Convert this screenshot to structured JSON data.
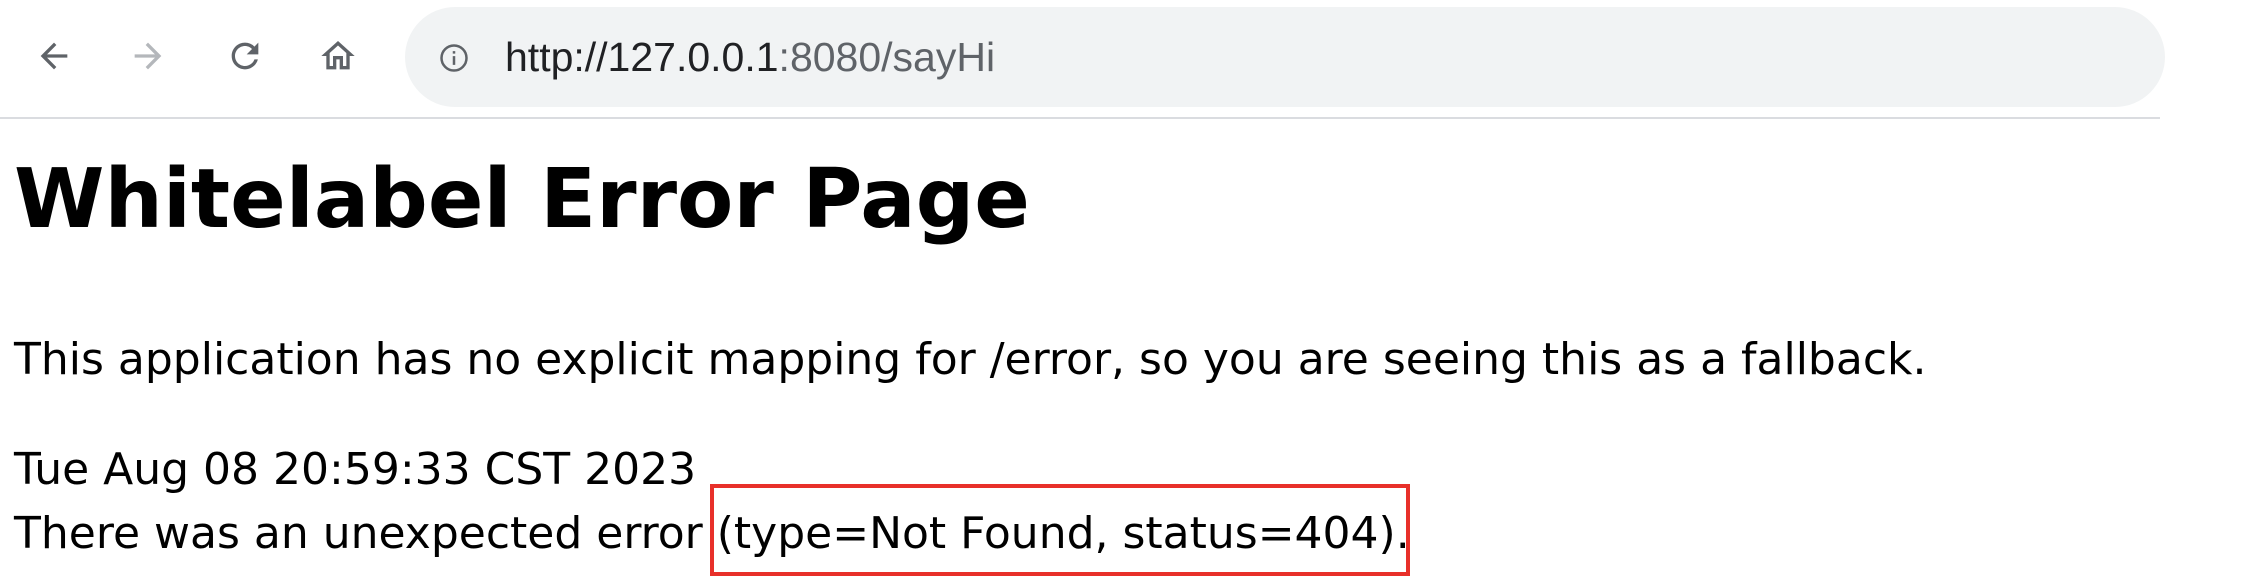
{
  "browser": {
    "nav": {
      "back_icon": "arrow-left-icon",
      "forward_icon": "arrow-right-icon",
      "reload_icon": "reload-icon",
      "home_icon": "home-icon"
    },
    "address_bar": {
      "info_icon": "info-circle-icon",
      "url_host": "http://127.0.0.1",
      "url_rest": ":8080/sayHi"
    }
  },
  "page": {
    "title": "Whitelabel Error Page",
    "message": "This application has no explicit mapping for /error, so you are seeing this as a fallback.",
    "timestamp": "Tue Aug 08 20:59:33 CST 2023",
    "error_line": "There was an unexpected error (type=Not Found, status=404)."
  },
  "annotation": {
    "color": "#e8302a"
  }
}
